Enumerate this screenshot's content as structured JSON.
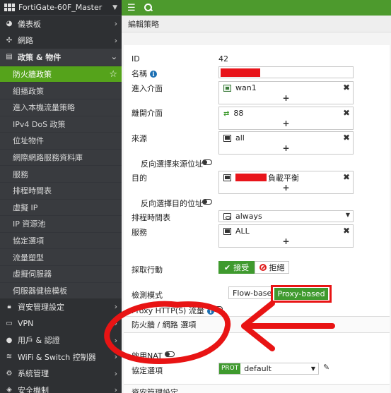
{
  "device": {
    "name": "FortiGate-60F_Master"
  },
  "sidebar": {
    "items": [
      {
        "label": "儀表板",
        "icon": "dashboard-icon"
      },
      {
        "label": "網路",
        "icon": "network-icon"
      },
      {
        "label": "政策 & 物件",
        "icon": "policy-icon"
      },
      {
        "label": "防火牆政策",
        "sub": true,
        "active": true
      },
      {
        "label": "組播政策",
        "sub": true
      },
      {
        "label": "進入本機流量策略",
        "sub": true
      },
      {
        "label": "IPv4 DoS 政策",
        "sub": true
      },
      {
        "label": "位址物件",
        "sub": true
      },
      {
        "label": "網際網路服務資料庫",
        "sub": true
      },
      {
        "label": "服務",
        "sub": true
      },
      {
        "label": "排程時間表",
        "sub": true
      },
      {
        "label": "虛擬 IP",
        "sub": true
      },
      {
        "label": "IP 資源池",
        "sub": true
      },
      {
        "label": "協定選項",
        "sub": true
      },
      {
        "label": "流量塑型",
        "sub": true
      },
      {
        "label": "虛擬伺服器",
        "sub": true
      },
      {
        "label": "伺服器健檢模板",
        "sub": true
      },
      {
        "label": "資安管理設定",
        "icon": "lock-icon"
      },
      {
        "label": "VPN",
        "icon": "vpn-icon"
      },
      {
        "label": "用戶 & 認證",
        "icon": "user-icon"
      },
      {
        "label": "WiFi & Switch 控制器",
        "icon": "wifi-icon"
      },
      {
        "label": "系統管理",
        "icon": "gear-icon"
      },
      {
        "label": "安全機制",
        "icon": "shield-icon"
      }
    ]
  },
  "page": {
    "title": "編輯策略"
  },
  "form": {
    "id_label": "ID",
    "id_value": "42",
    "name_label": "名稱",
    "in_iface_label": "進入介面",
    "in_iface_value": "wan1",
    "out_iface_label": "離開介面",
    "out_iface_value": "88",
    "src_label": "來源",
    "src_value": "all",
    "neg_src_label": "反向選擇來源位址",
    "dst_label": "目的",
    "dst_suffix": "負載平衡",
    "neg_dst_label": "反向選擇目的位址",
    "schedule_label": "排程時間表",
    "schedule_value": "always",
    "service_label": "服務",
    "service_value": "ALL",
    "action_label": "採取行動",
    "accept_label": "接受",
    "deny_label": "拒絕",
    "inspection_label": "檢測模式",
    "flow_label": "Flow-based",
    "proxy_label": "Proxy-based",
    "proxy_http_label": "Proxy HTTP(S) 流量",
    "fw_section_title": "防火牆 / 網路 選項",
    "nat_label": "啟用NAT",
    "protocol_label": "協定選項",
    "protocol_tag": "PROT",
    "protocol_value": "default",
    "security_section_title": "資安管理設定",
    "add_symbol": "+",
    "remove_symbol": "✖"
  },
  "colors": {
    "accent_green": "#4d9a2d",
    "annotation_red": "#e81414",
    "sidebar_bg": "#2e3033"
  }
}
